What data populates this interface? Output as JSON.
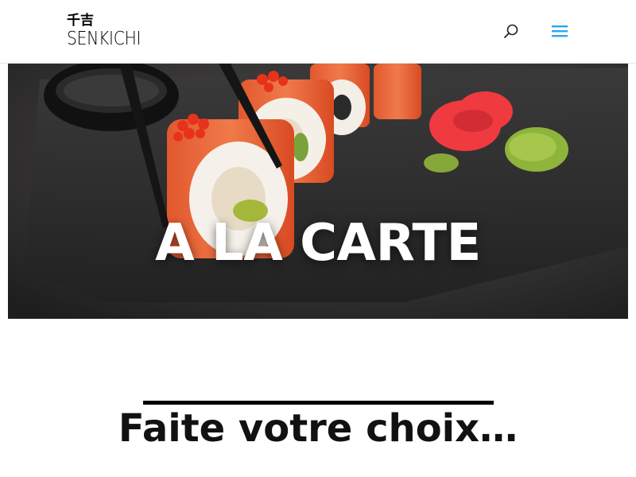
{
  "header": {
    "logo_kanji": "千吉",
    "logo_name": "SENKICHI",
    "search_icon": "search-icon",
    "menu_icon": "hamburger-menu-icon",
    "accent_color": "#2ea3f2"
  },
  "hero": {
    "title": "A LA CARTE"
  },
  "section": {
    "title": "Faite votre choix…"
  }
}
